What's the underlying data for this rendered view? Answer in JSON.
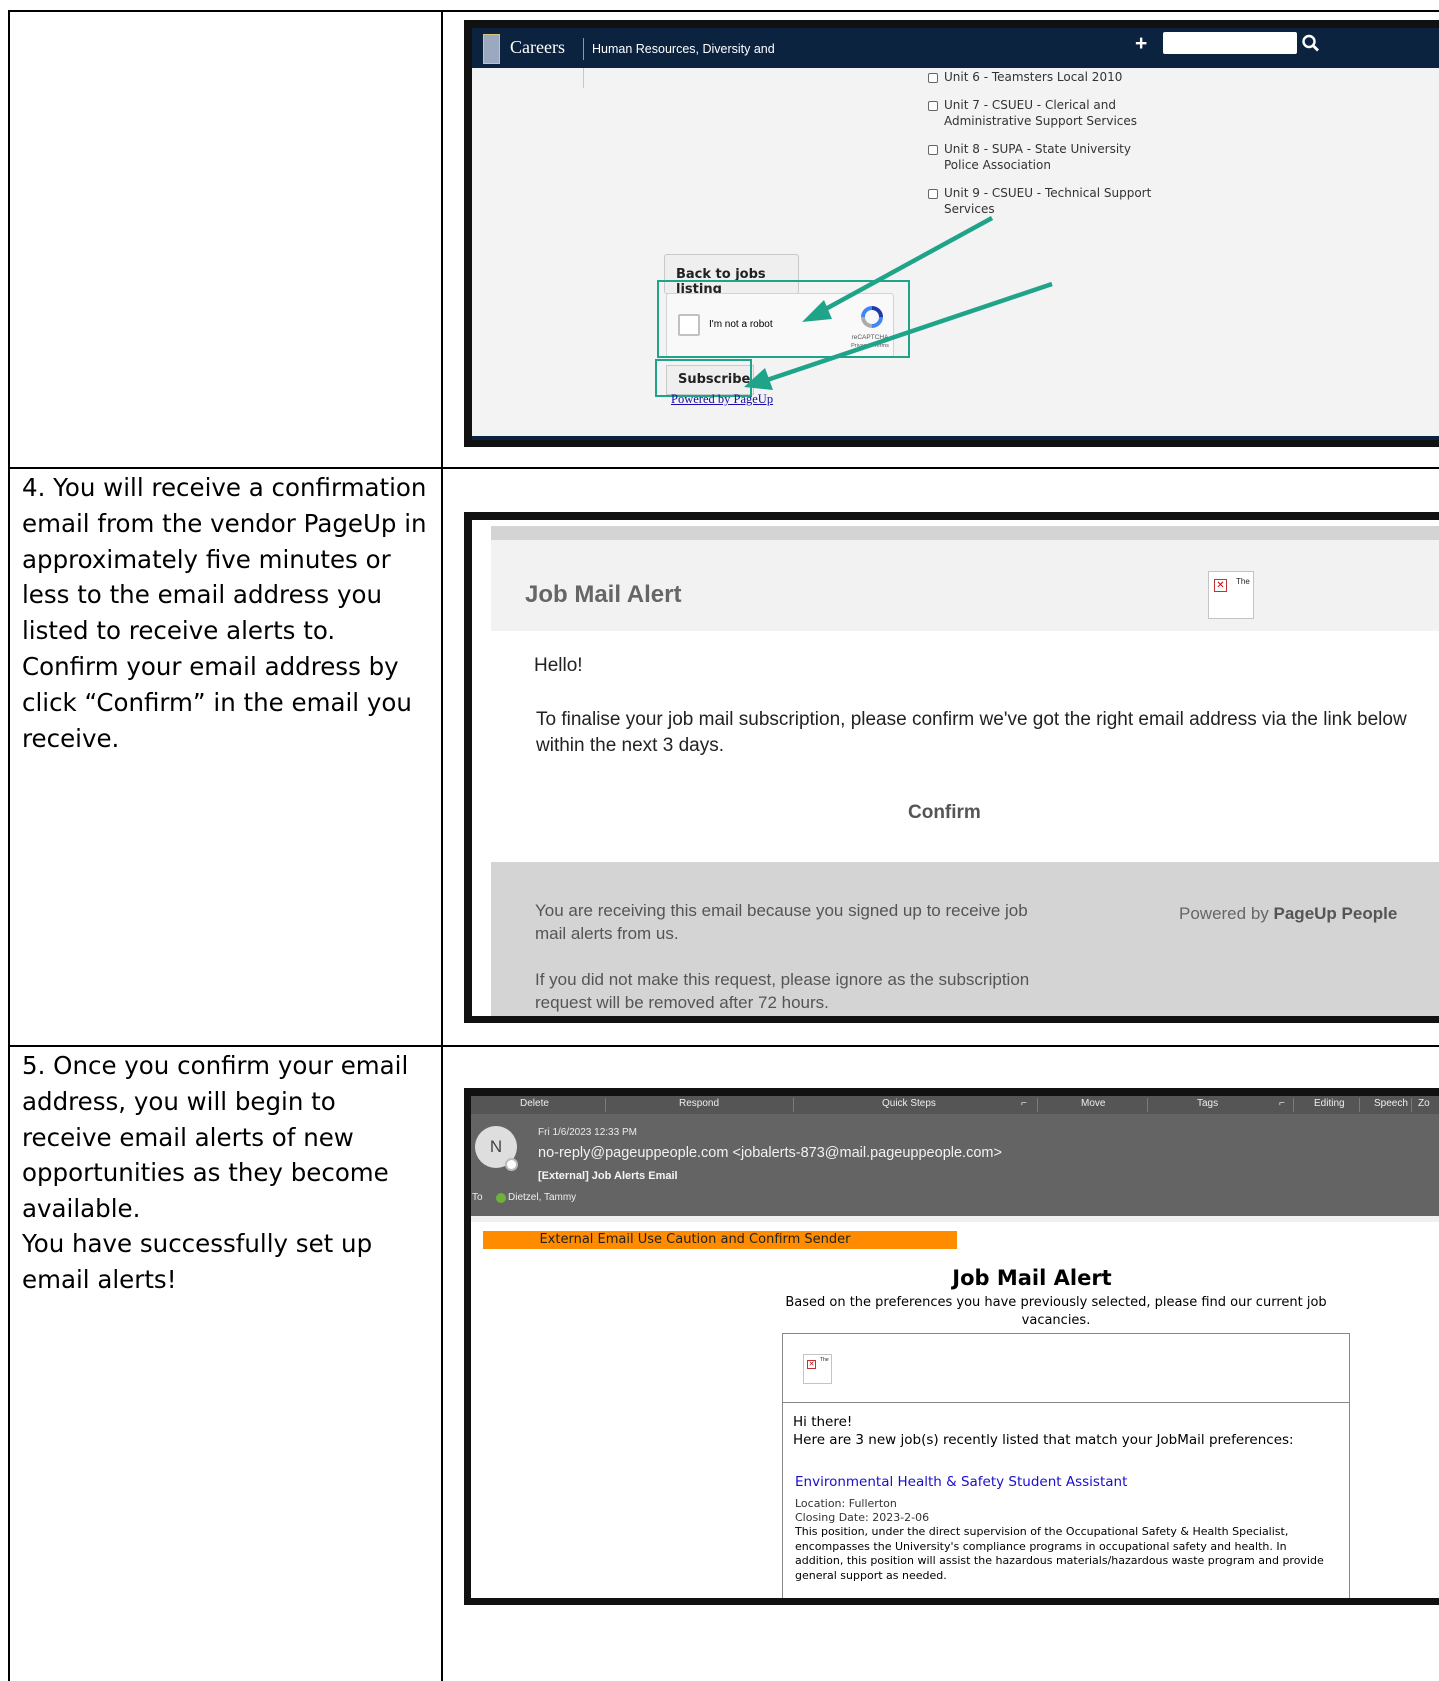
{
  "steps": {
    "step4": "4. You will receive a confirmation email from the vendor PageUp in approximately five minutes or less to the email address you listed to receive alerts to. Confirm your email address by click “Confirm” in the email you receive.",
    "step5_line1": "5. Once you confirm your email address, you will begin to receive email alerts of new opportunities as they become available.",
    "step5_line2": "You have successfully set up email alerts!"
  },
  "screenshot1": {
    "header": {
      "careers": "Careers",
      "department": "Human Resources, Diversity and",
      "plus_icon": "+",
      "search_placeholder": ""
    },
    "units": [
      "Unit 6 - Teamsters Local 2010",
      "Unit 7 - CSUEU - Clerical and Administrative Support Services",
      "Unit 8 - SUPA - State University Police Association",
      "Unit 9 - CSUEU - Technical Support Services"
    ],
    "back_button": "Back to jobs listing",
    "captcha": {
      "label": "I'm not a robot",
      "brand": "reCAPTCHA",
      "links": "Privacy - Terms"
    },
    "subscribe_button": "Subscribe",
    "powered_link": "Powered by PageUp",
    "highlight_color": "#20a489"
  },
  "screenshot2": {
    "title": "Job Mail Alert",
    "image_alt": "The",
    "greeting": "Hello!",
    "message": "To finalise your job mail subscription, please confirm we've got the right email address via the link below within the next 3 days.",
    "confirm_link": "Confirm",
    "footer_reason": "You are receiving this email because you signed up to receive job mail alerts from us.",
    "footer_ignore": "If you did not make this request, please ignore as the subscription request will be removed after 72 hours.",
    "powered_prefix": "Powered by",
    "powered_brand": "PageUp People"
  },
  "screenshot3": {
    "ribbon": [
      "Delete",
      "Respond",
      "Quick Steps",
      "Move",
      "Tags",
      "Editing",
      "Speech",
      "Zo"
    ],
    "avatar_initial": "N",
    "date": "Fri 1/6/2023 12:33 PM",
    "from": "no-reply@pageuppeople.com <jobalerts-873@mail.pageuppeople.com>",
    "subject": "[External] Job Alerts Email",
    "to_label": "To",
    "to_name": "Dietzel, Tammy",
    "caution": "External Email Use Caution and Confirm Sender",
    "title": "Job Mail Alert",
    "subtitle": "Based on the preferences you have previously selected, please find our current job vacancies.",
    "image_alt": "The",
    "hi": "Hi there!",
    "intro": "Here are 3 new job(s) recently listed that match your JobMail preferences:",
    "job_title": "Environmental Health & Safety Student Assistant",
    "location": "Location: Fullerton",
    "closing": "Closing Date: 2023-2-06",
    "description": "This position, under the direct supervision of the Occupational Safety & Health Specialist, encompasses the University's compliance programs in occupational safety and health. In addition, this position will assist the hazardous materials/hazardous waste program and provide general support as needed."
  }
}
